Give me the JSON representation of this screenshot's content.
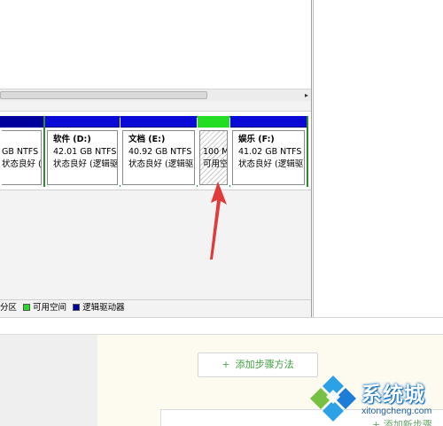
{
  "partitions": {
    "left": {
      "size": "GB NTFS",
      "status": "状态良好 (系统,"
    },
    "d": {
      "name": "软件  (D:)",
      "size": "42.01 GB NTFS",
      "status": "状态良好 (逻辑驱"
    },
    "e": {
      "name": "文档  (E:)",
      "size": "40.92 GB NTFS",
      "status": "状态良好 (逻辑驱"
    },
    "free": {
      "size": "100 M",
      "status": "可用空"
    },
    "f": {
      "name": "娱乐  (F:)",
      "size": "41.02 GB NTFS",
      "status": "状态良好 (逻辑驱"
    }
  },
  "legend": {
    "primary": "分区",
    "free": "可用空间",
    "logical": "逻辑驱动器"
  },
  "web": {
    "add_step_plus": "+",
    "add_step_label": "添加步骤方法",
    "bottom_link": "+ 添加新步骤"
  },
  "watermark": {
    "title": "系统城",
    "subtitle": "xitongcheng.com"
  },
  "colors": {
    "primary_bar": "#00009c",
    "logical_bar": "#0a0ad6",
    "free_bar": "#22dd22",
    "extended_border": "#2e8b2e",
    "arrow": "#e03a3a",
    "button_text": "#3f9e3f"
  }
}
